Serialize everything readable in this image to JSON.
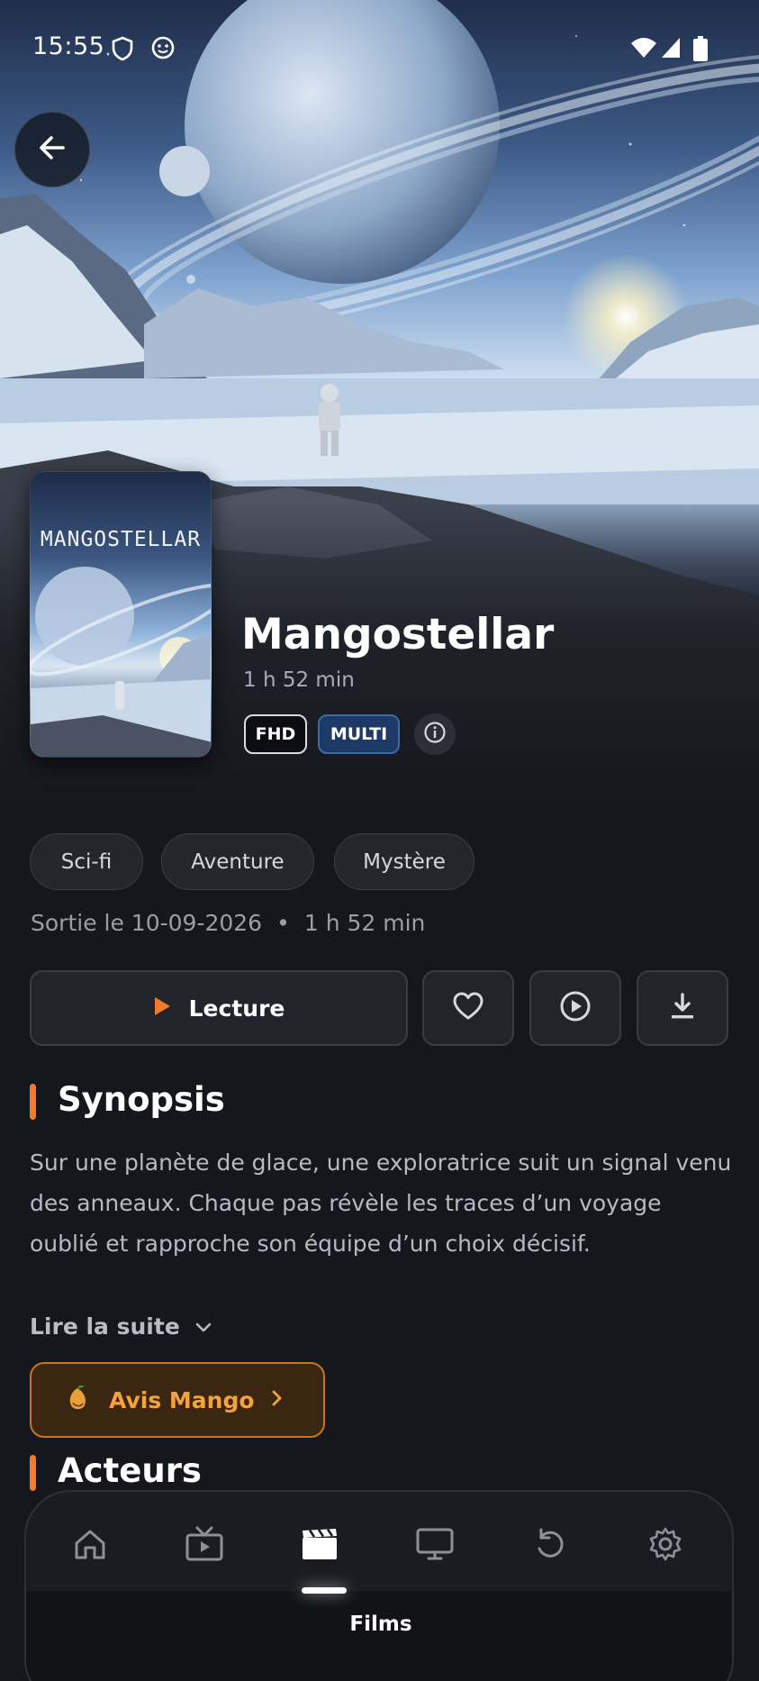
{
  "status_bar": {
    "time": "15:55",
    "icons": [
      "shield-icon",
      "emoji-face-icon",
      "wifi-icon",
      "signal-icon",
      "battery-icon"
    ]
  },
  "header": {
    "back_icon": "arrow-left-icon"
  },
  "poster": {
    "title": "MANGOSTELLAR"
  },
  "movie": {
    "title": "Mangostellar",
    "duration": "1 h 52 min",
    "badges": [
      "FHD",
      "MULTI"
    ],
    "info_icon": "info-icon"
  },
  "genres": [
    "Sci-fi",
    "Aventure",
    "Mystère"
  ],
  "release": {
    "date": "Sortie le 10-09-2026",
    "separator": "•",
    "duration": "1 h 52 min"
  },
  "actions": {
    "play_label": "Lecture",
    "icons": [
      "play-icon",
      "heart-icon",
      "trailer-icon",
      "download-icon"
    ]
  },
  "synopsis": {
    "heading": "Synopsis",
    "text": "Sur une planète de glace, une exploratrice suit un signal venu des anneaux. Chaque pas révèle les traces d’un voyage oublié et rapproche son équipe d’un choix décisif.",
    "read_more": "Lire la suite"
  },
  "avis": {
    "label": "Avis Mango",
    "icon": "mango-icon"
  },
  "cast": {
    "heading": "Acteurs"
  },
  "bottom_nav": {
    "items": [
      "home-icon",
      "tv-icon",
      "films-icon",
      "screen-icon",
      "history-icon",
      "settings-icon"
    ],
    "active_label": "Films"
  },
  "colors": {
    "accent": "#f07b2e",
    "avis_text": "#f5a23c",
    "background": "#15171d",
    "multi_badge": "#1d3a66"
  }
}
